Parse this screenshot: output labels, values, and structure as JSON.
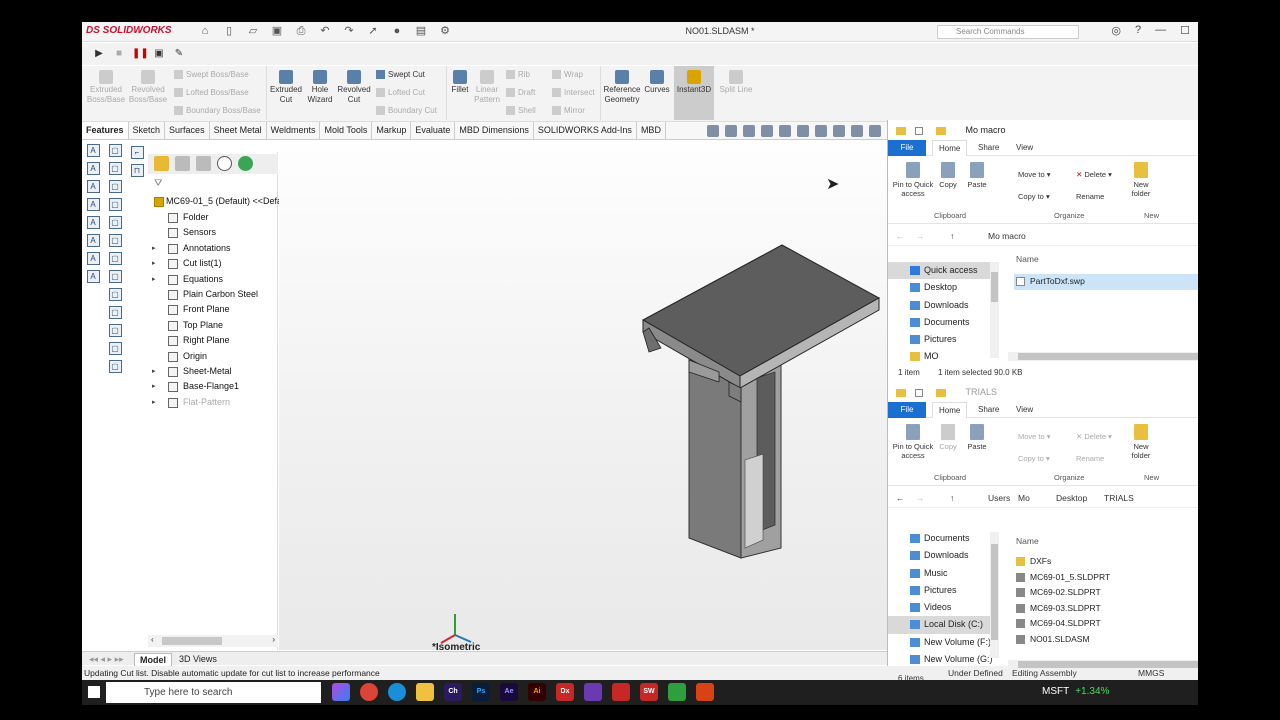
{
  "app": {
    "logo": "DS SOLIDWORKS",
    "doc_title": "NO01.SLDASM *",
    "search_placeholder": "Search Commands"
  },
  "ribbon": {
    "buttons": [
      {
        "label": "Extruded Boss/Base",
        "enabled": false
      },
      {
        "label": "Revolved Boss/Base",
        "enabled": false
      },
      {
        "label": "Extruded Cut",
        "enabled": true
      },
      {
        "label": "Hole Wizard",
        "enabled": true
      },
      {
        "label": "Revolved Cut",
        "enabled": true
      },
      {
        "label": "Fillet",
        "enabled": true
      },
      {
        "label": "Linear Pattern",
        "enabled": false
      },
      {
        "label": "Reference Geometry",
        "enabled": true
      },
      {
        "label": "Curves",
        "enabled": true
      },
      {
        "label": "Instant3D",
        "enabled": true
      },
      {
        "label": "Split Line",
        "enabled": false
      }
    ],
    "small": [
      {
        "label": "Swept Boss/Base",
        "enabled": false
      },
      {
        "label": "Lofted Boss/Base",
        "enabled": false
      },
      {
        "label": "Boundary Boss/Base",
        "enabled": false
      },
      {
        "label": "Swept Cut",
        "enabled": true
      },
      {
        "label": "Lofted Cut",
        "enabled": false
      },
      {
        "label": "Boundary Cut",
        "enabled": false
      },
      {
        "label": "Rib",
        "enabled": false
      },
      {
        "label": "Draft",
        "enabled": false
      },
      {
        "label": "Shell",
        "enabled": false
      },
      {
        "label": "Wrap",
        "enabled": false
      },
      {
        "label": "Intersect",
        "enabled": false
      },
      {
        "label": "Mirror",
        "enabled": false
      }
    ]
  },
  "tabs": [
    "Features",
    "Sketch",
    "Surfaces",
    "Sheet Metal",
    "Weldments",
    "Mold Tools",
    "Markup",
    "Evaluate",
    "MBD Dimensions",
    "SOLIDWORKS Add-Ins",
    "MBD"
  ],
  "tree": {
    "root": "MC69-01_5 (Default) <<Defa",
    "items": [
      {
        "label": "Folder",
        "expander": false,
        "gray": false
      },
      {
        "label": "Sensors",
        "expander": false,
        "gray": false
      },
      {
        "label": "Annotations",
        "expander": true,
        "gray": false
      },
      {
        "label": "Cut list(1)",
        "expander": true,
        "gray": false
      },
      {
        "label": "Equations",
        "expander": true,
        "gray": false
      },
      {
        "label": "Plain Carbon Steel",
        "expander": false,
        "gray": false
      },
      {
        "label": "Front Plane",
        "expander": false,
        "gray": false
      },
      {
        "label": "Top Plane",
        "expander": false,
        "gray": false
      },
      {
        "label": "Right Plane",
        "expander": false,
        "gray": false
      },
      {
        "label": "Origin",
        "expander": false,
        "gray": false
      },
      {
        "label": "Sheet-Metal",
        "expander": true,
        "gray": false
      },
      {
        "label": "Base-Flange1",
        "expander": true,
        "gray": false
      },
      {
        "label": "Flat-Pattern",
        "expander": true,
        "gray": true
      }
    ]
  },
  "graphics": {
    "view_label": "*Isometric"
  },
  "bottom_tabs": [
    "Model",
    "3D Views"
  ],
  "status": {
    "message": "Updating Cut list. Disable automatic update for cut list to increase performance",
    "state": "Under Defined",
    "mode": "Editing Assembly",
    "units": "MMGS"
  },
  "explorer1": {
    "title": "Mo macro",
    "menu": [
      "File",
      "Home",
      "Share",
      "View"
    ],
    "ribbon": [
      {
        "label": "Pin to Quick access",
        "enabled": true
      },
      {
        "label": "Copy",
        "enabled": true
      },
      {
        "label": "Paste",
        "enabled": true
      },
      {
        "label": "Move to",
        "enabled": true
      },
      {
        "label": "Delete",
        "enabled": true
      },
      {
        "label": "Copy to",
        "enabled": true
      },
      {
        "label": "Rename",
        "enabled": true
      },
      {
        "label": "New folder",
        "enabled": true
      }
    ],
    "groups": [
      "Clipboard",
      "Organize",
      "New"
    ],
    "address": [
      "Mo macro"
    ],
    "nav": [
      {
        "label": "Quick access",
        "selected": true
      },
      {
        "label": "Desktop"
      },
      {
        "label": "Downloads"
      },
      {
        "label": "Documents"
      },
      {
        "label": "Pictures"
      },
      {
        "label": "MO"
      }
    ],
    "col_name": "Name",
    "files": [
      {
        "name": "PartToDxf.swp",
        "selected": true
      }
    ],
    "status_count": "1 item",
    "status_sel": "1 item selected  90.0 KB"
  },
  "explorer2": {
    "title": "TRIALS",
    "menu": [
      "File",
      "Home",
      "Share",
      "View"
    ],
    "ribbon": [
      {
        "label": "Pin to Quick access",
        "enabled": true
      },
      {
        "label": "Copy",
        "enabled": false
      },
      {
        "label": "Paste",
        "enabled": true
      },
      {
        "label": "Move to",
        "enabled": false
      },
      {
        "label": "Delete",
        "enabled": false
      },
      {
        "label": "Copy to",
        "enabled": false
      },
      {
        "label": "Rename",
        "enabled": false
      },
      {
        "label": "New folder",
        "enabled": true
      }
    ],
    "groups": [
      "Clipboard",
      "Organize",
      "New"
    ],
    "address": [
      "Users",
      "Mo",
      "Desktop",
      "TRIALS"
    ],
    "nav": [
      {
        "label": "Documents"
      },
      {
        "label": "Downloads"
      },
      {
        "label": "Music"
      },
      {
        "label": "Pictures"
      },
      {
        "label": "Videos"
      },
      {
        "label": "Local Disk (C:)",
        "selected": true
      },
      {
        "label": "New Volume (F:)"
      },
      {
        "label": "New Volume (G:)"
      }
    ],
    "col_name": "Name",
    "files": [
      {
        "name": "DXFs"
      },
      {
        "name": "MC69-01_5.SLDPRT"
      },
      {
        "name": "MC69-02.SLDPRT"
      },
      {
        "name": "MC69-03.SLDPRT"
      },
      {
        "name": "MC69-04.SLDPRT"
      },
      {
        "name": "NO01.SLDASM"
      }
    ],
    "status_count": "6 items"
  },
  "taskbar": {
    "search_placeholder": "Type here to search",
    "apps": [
      "Ch",
      "Ps",
      "Ae",
      "Ai",
      "Dx",
      "SW"
    ],
    "stock": "MSFT",
    "stock_change": "+1.34%"
  },
  "colors": {
    "accent": "#1a6fd0",
    "brand": "#c8102e",
    "stock_up": "#4cd964"
  }
}
